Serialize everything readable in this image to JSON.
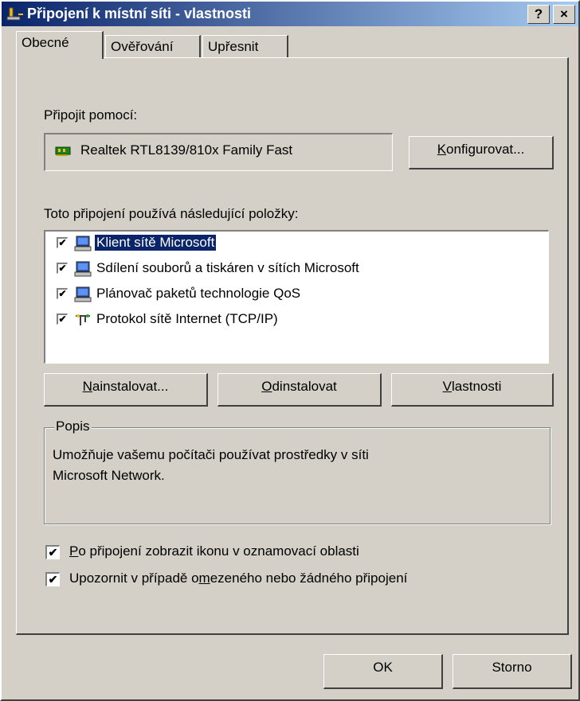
{
  "window": {
    "title": "Připojení k místní síti - vlastnosti",
    "help_label": "?",
    "close_label": "×"
  },
  "tabs": [
    {
      "label": "Obecné",
      "active": true
    },
    {
      "label": "Ověřování",
      "active": false
    },
    {
      "label": "Upřesnit",
      "active": false
    }
  ],
  "general": {
    "connect_using_label": "Připojit pomocí:",
    "adapter_name": "Realtek RTL8139/810x Family Fast",
    "configure_button": {
      "accel": "K",
      "rest": "onfigurovat..."
    },
    "items_label": {
      "pre": "Toto připo",
      "accel": "j",
      "post": "ení používá následující položky:"
    },
    "components": [
      {
        "label": "Klient sítě Microsoft",
        "checked": true,
        "selected": true,
        "icon": "network-client-icon"
      },
      {
        "label": "Sdílení souborů a tiskáren v sítích Microsoft",
        "checked": true,
        "selected": false,
        "icon": "network-service-icon"
      },
      {
        "label": "Plánovač paketů technologie QoS",
        "checked": true,
        "selected": false,
        "icon": "network-service-icon"
      },
      {
        "label": "Protokol sítě Internet (TCP/IP)",
        "checked": true,
        "selected": false,
        "icon": "network-protocol-icon"
      }
    ],
    "install_button": {
      "accel": "N",
      "rest": "ainstalovat..."
    },
    "uninstall_button": {
      "accel": "O",
      "rest": "dinstalovat"
    },
    "properties_button": {
      "accel": "V",
      "rest": "lastnosti"
    },
    "description_legend": "Popis",
    "description_text_line1": "Umožňuje vašemu počítači používat prostředky v síti",
    "description_text_line2": "Microsoft Network.",
    "option_show_icon": {
      "accel": "P",
      "rest": "o připojení zobrazit ikonu v oznamovací oblasti",
      "checked": true
    },
    "option_notify": {
      "pre": "Upozornit v případě o",
      "accel": "m",
      "post": "ezeného nebo žádného připojení",
      "checked": true
    }
  },
  "footer": {
    "ok_label": "OK",
    "cancel_label": "Storno"
  },
  "colors": {
    "titlebar_start": "#0a246a",
    "titlebar_end": "#a6caf0",
    "face": "#d4d0c8",
    "selection": "#0a246a"
  }
}
